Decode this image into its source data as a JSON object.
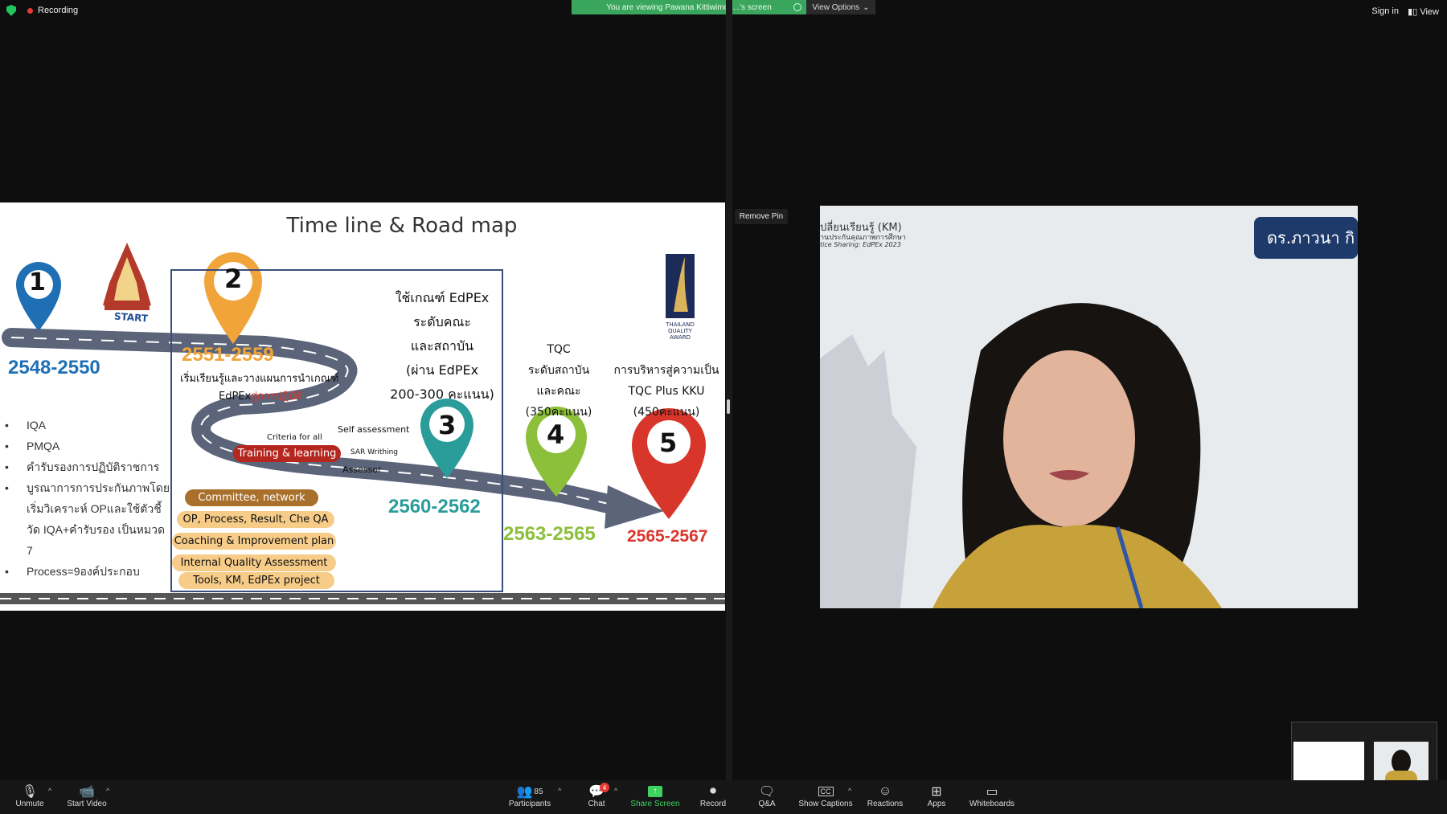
{
  "topbar": {
    "recording_label": "Recording",
    "viewing_banner": "You are viewing Pawana Kittiwimon...'s screen",
    "view_options_label": "View Options",
    "sign_in_label": "Sign in",
    "view_label": "View"
  },
  "slide": {
    "title": "Time line & Road map",
    "start_label": "START",
    "award_label_lines": [
      "THAILAND",
      "QUALITY",
      "AWARD"
    ],
    "pins": [
      "1",
      "2",
      "3",
      "4",
      "5"
    ],
    "years": {
      "y1": "2548-2550",
      "y2": "2551-2559",
      "y3": "2560-2562",
      "y4": "2563-2565",
      "y5": "2565-2567"
    },
    "stage1_bullets": [
      "IQA",
      "PMQA",
      "คำรับรองการปฏิบัติราชการ",
      "บูรณาการการประกันภาพโดยเริ่มวิเคราะห์ OPและใช้ตัวชี้วัด IQA+คำรับรอง เป็นหมวด 7",
      "Process=9องค์ประกอบ"
    ],
    "stage2_line1": "เริ่มเรียนรู้และวางแผนการนำเกณฑ์",
    "stage2_line2a": "EdPEx",
    "stage2_line2b": "สู่การปฏิบัติ",
    "stage3_text": [
      "ใช้เกณฑ์ EdPEx",
      "ระดับคณะ",
      "และสถาบัน",
      "(ผ่าน EdPEx",
      "200-300 คะแนน)"
    ],
    "stage4_text": [
      "TQC",
      "ระดับสถาบัน",
      "และคณะ",
      "(350คะแนน)"
    ],
    "stage5_text": [
      "การบริหารสู่ความเป็น",
      "TQC Plus KKU",
      "(450คะแนน)"
    ],
    "criteria_label": "Criteria for all",
    "training_label": "Training & learning",
    "self_assessment": "Self assessment",
    "sar_writing": "SAR Writhing",
    "assessor": "Assessor",
    "pills": [
      "Committee, network",
      "OP, Process, Result, Che QA",
      "Coaching & Improvement plan",
      "Internal Quality Assessment",
      "Tools, KM, EdPEx project"
    ]
  },
  "camera": {
    "remove_pin_label": "Remove Pin",
    "banner_text": "ดร.ภาวนา กิ",
    "bg_text_line1": "ปลี่ยนเรียนรู้ (KM)",
    "bg_text_line2": "านประกันคุณภาพการศึกษา",
    "bg_text_line3": "tice Sharing: EdPEx 2023"
  },
  "toolbar": {
    "unmute": "Unmute",
    "start_video": "Start Video",
    "participants": "Participants",
    "participants_count": "85",
    "chat": "Chat",
    "chat_badge": "4",
    "share_screen": "Share Screen",
    "record": "Record",
    "qa": "Q&A",
    "show_captions": "Show Captions",
    "reactions": "Reactions",
    "apps": "Apps",
    "whiteboards": "Whiteboards"
  },
  "colors": {
    "pin1": "#1f6fb5",
    "pin2": "#f0a43a",
    "pin3": "#2a9d9a",
    "pin4": "#8cbf3a",
    "pin5": "#d9362b",
    "road": "#5b6478",
    "share_green": "#3dd35f",
    "banner_green": "#3aa55d"
  }
}
